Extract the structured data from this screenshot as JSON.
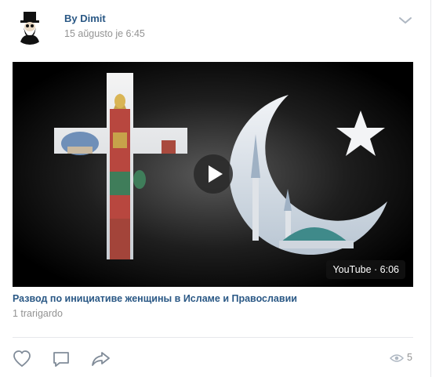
{
  "post": {
    "author": "By Dimit",
    "date": "15 aŭgusto je 6:45",
    "menu_icon": "chevron-down-icon"
  },
  "video": {
    "badge": "YouTube · 6:06",
    "title": "Развод по инициативе женщины в Исламе и Православии",
    "views": "1 trarigardo"
  },
  "actions": {
    "like_icon": "heart-icon",
    "comment_icon": "comment-icon",
    "share_icon": "share-icon",
    "views_icon": "eye-icon",
    "views_count": "5"
  },
  "colors": {
    "link": "#2a5885",
    "muted": "#939393",
    "icon": "#818c99",
    "divider": "#e7e8ec"
  }
}
